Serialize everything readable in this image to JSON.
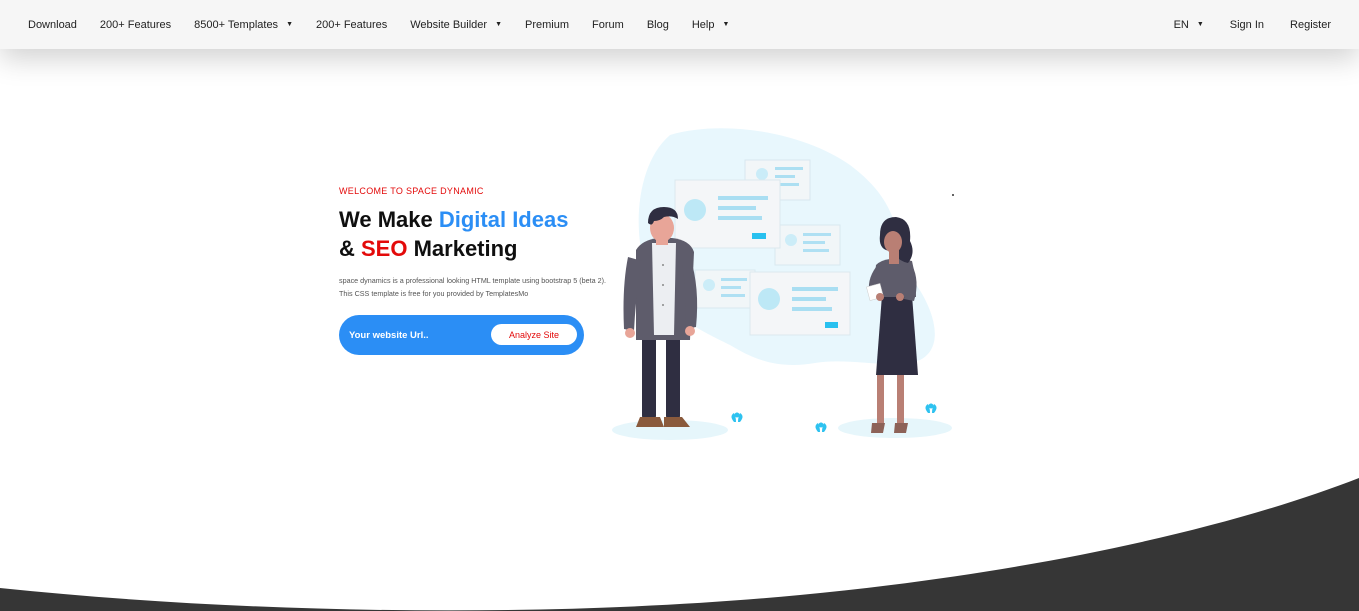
{
  "nav": {
    "left": [
      {
        "label": "Download",
        "dropdown": false
      },
      {
        "label": "200+ Features",
        "dropdown": false
      },
      {
        "label": "8500+ Templates",
        "dropdown": true
      },
      {
        "label": "200+ Features",
        "dropdown": false
      },
      {
        "label": "Website Builder",
        "dropdown": true
      },
      {
        "label": "Premium",
        "dropdown": false
      },
      {
        "label": "Forum",
        "dropdown": false
      },
      {
        "label": "Blog",
        "dropdown": false
      },
      {
        "label": "Help",
        "dropdown": true
      }
    ],
    "right": {
      "language": "EN",
      "sign_in": "Sign In",
      "register": "Register"
    },
    "caret_glyph": "▼"
  },
  "hero": {
    "eyebrow": "WELCOME TO SPACE DYNAMIC",
    "headline_line1_plain": "We Make ",
    "headline_line1_accent": "Digital Ideas",
    "headline_line2_prefix": "& ",
    "headline_line2_accent": "SEO",
    "headline_line2_suffix": " Marketing",
    "description": "space dynamics is a professional looking HTML template using bootstrap 5 (beta 2). This CSS template is free for you provided by TemplatesMo"
  },
  "search": {
    "placeholder": "Your website Url..",
    "button_label": "Analyze Site"
  },
  "colors": {
    "accent_blue": "#2b8ef5",
    "accent_red": "#e30a0a",
    "nav_bg": "#f6f6f6",
    "footer_dark": "#363636"
  },
  "icons": {
    "caret": "caret-down-icon"
  }
}
